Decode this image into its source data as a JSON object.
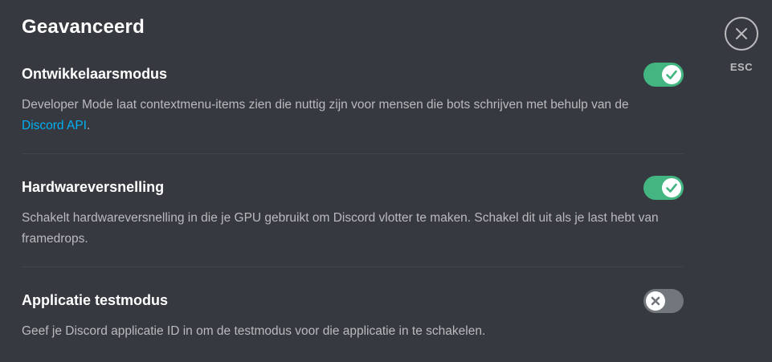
{
  "page": {
    "title": "Geavanceerd"
  },
  "settings": [
    {
      "title": "Ontwikkelaarsmodus",
      "description": "Developer Mode laat contextmenu-items zien die nuttig zijn voor mensen die bots schrijven met behulp van de ",
      "link_text": "Discord API",
      "description_suffix": ".",
      "enabled": true
    },
    {
      "title": "Hardwareversnelling",
      "description": "Schakelt hardwareversnelling in die je GPU gebruikt om Discord vlotter te maken. Schakel dit uit als je last hebt van framedrops.",
      "enabled": true
    },
    {
      "title": "Applicatie testmodus",
      "description": "Geef je Discord applicatie ID in om de testmodus voor die applicatie in te schakelen.",
      "enabled": false
    }
  ],
  "close": {
    "label": "ESC",
    "icon": "close-icon"
  },
  "colors": {
    "background": "#36393f",
    "toggle_on": "#43b581",
    "toggle_off": "#72767d",
    "link": "#00b0f4"
  }
}
